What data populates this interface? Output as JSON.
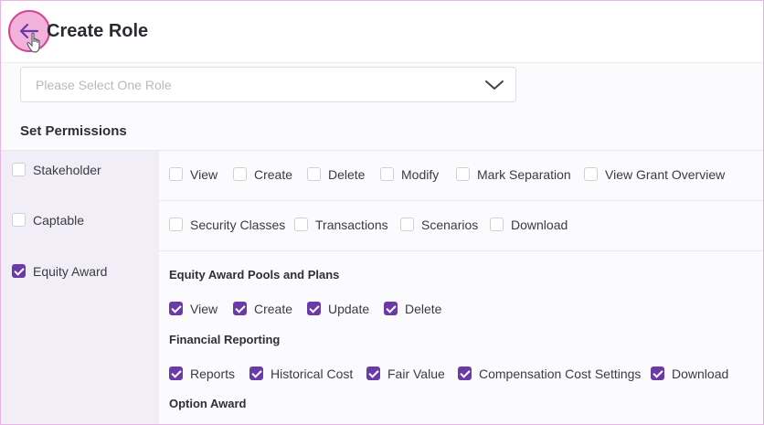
{
  "header": {
    "title": "Create Role"
  },
  "role_select": {
    "placeholder": "Please Select One Role"
  },
  "permissions": {
    "section_title": "Set Permissions",
    "modules": [
      {
        "label": "Stakeholder",
        "checked": false,
        "actions": [
          "View",
          "Create",
          "Delete",
          "Modify",
          "Mark Separation",
          "View Grant Overview"
        ]
      },
      {
        "label": "Captable",
        "checked": false,
        "actions": [
          "Security Classes",
          "Transactions",
          "Scenarios",
          "Download"
        ]
      },
      {
        "label": "Equity Award",
        "checked": true,
        "groups": [
          {
            "title": "Equity Award Pools and Plans",
            "actions": [
              "View",
              "Create",
              "Update",
              "Delete"
            ]
          },
          {
            "title": "Financial Reporting",
            "actions": [
              "Reports",
              "Historical Cost",
              "Fair Value",
              "Compensation Cost Settings",
              "Download"
            ]
          },
          {
            "title": "Option Award",
            "actions": []
          }
        ]
      }
    ]
  },
  "colors": {
    "accent": "#6a3aa8",
    "left_panel": "#f1eef8",
    "cursor_highlight": "#f3b2dc"
  },
  "icons": {
    "back": "arrow-left-icon",
    "cursor": "hand-pointer-icon",
    "dropdown": "chevron-down-icon"
  }
}
